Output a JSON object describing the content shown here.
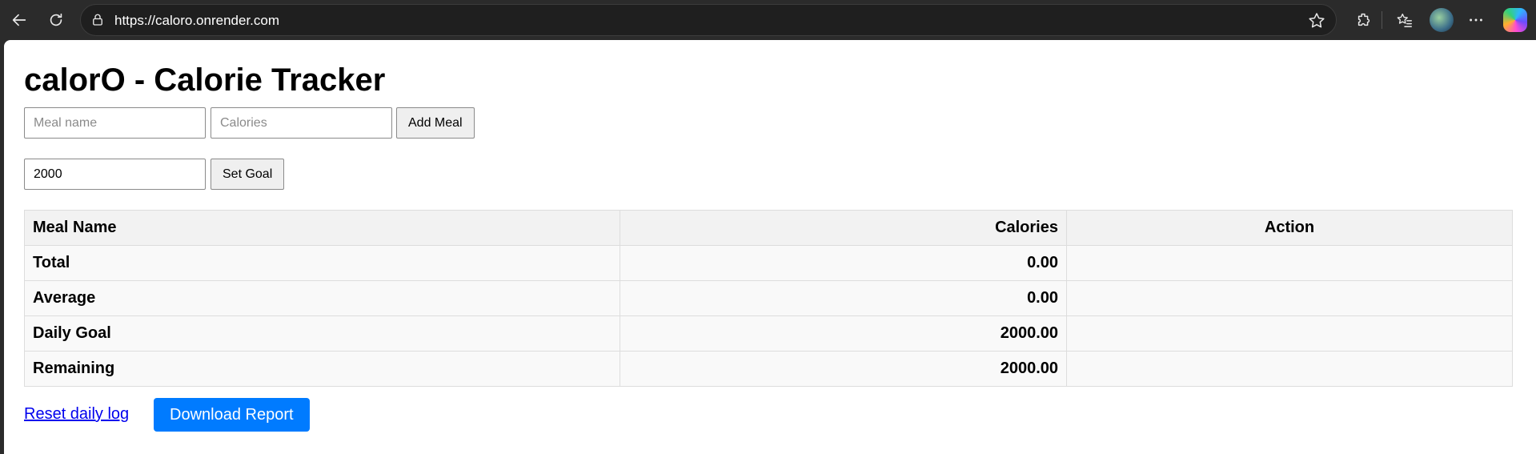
{
  "browser": {
    "url": "https://caloro.onrender.com"
  },
  "app": {
    "title": "calorO - Calorie Tracker"
  },
  "meal_form": {
    "meal_placeholder": "Meal name",
    "calories_placeholder": "Calories",
    "add_label": "Add Meal"
  },
  "goal_form": {
    "goal_value": "2000",
    "set_label": "Set Goal"
  },
  "table": {
    "headers": [
      "Meal Name",
      "Calories",
      "Action"
    ],
    "rows": [
      {
        "name": "Total",
        "calories": "0.00",
        "action": ""
      },
      {
        "name": "Average",
        "calories": "0.00",
        "action": ""
      },
      {
        "name": "Daily Goal",
        "calories": "2000.00",
        "action": ""
      },
      {
        "name": "Remaining",
        "calories": "2000.00",
        "action": ""
      }
    ]
  },
  "footer": {
    "reset_label": "Reset daily log",
    "download_label": "Download Report"
  },
  "colors": {
    "primary": "#007bff",
    "link": "#0000ee",
    "chrome": "#2b2b2b"
  }
}
